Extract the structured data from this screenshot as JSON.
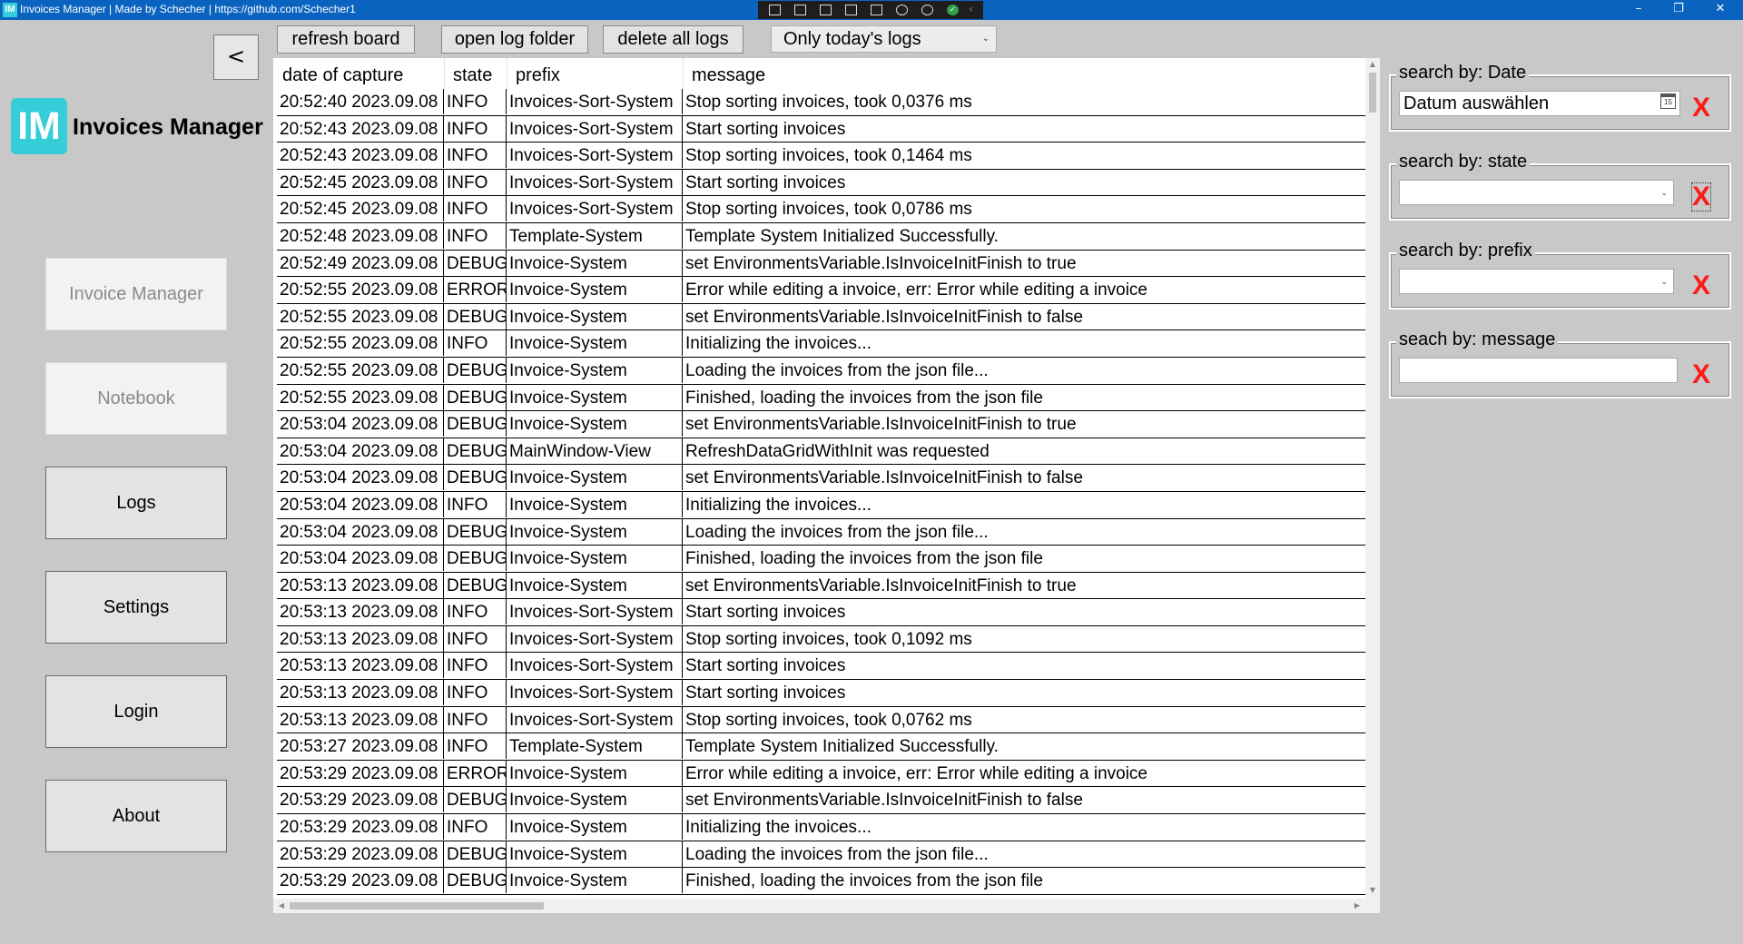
{
  "window": {
    "app_icon_text": "IM",
    "title": "Invoices Manager | Made by Schecher | https://github.com/Schecher1",
    "controls": {
      "minimize": "–",
      "maximize": "❐",
      "close": "✕"
    }
  },
  "sidebar": {
    "back_label": "<",
    "logo_text": "IM",
    "app_name": "Invoices Manager",
    "nav": [
      {
        "label": "Invoice Manager",
        "enabled": false
      },
      {
        "label": "Notebook",
        "enabled": false
      },
      {
        "label": "Logs",
        "enabled": true
      },
      {
        "label": "Settings",
        "enabled": true
      },
      {
        "label": "Login",
        "enabled": true
      },
      {
        "label": "About",
        "enabled": true
      }
    ]
  },
  "toolbar": {
    "refresh_label": "refresh board",
    "open_folder_label": "open log folder",
    "delete_label": "delete all logs",
    "log_filter_value": "Only today's logs"
  },
  "grid": {
    "columns": [
      "date of capture",
      "state",
      "prefix",
      "message"
    ],
    "rows": [
      [
        "20:52:40 2023.09.08",
        "INFO",
        "Invoices-Sort-System",
        "Stop sorting invoices, took 0,0376 ms"
      ],
      [
        "20:52:43 2023.09.08",
        "INFO",
        "Invoices-Sort-System",
        "Start sorting invoices"
      ],
      [
        "20:52:43 2023.09.08",
        "INFO",
        "Invoices-Sort-System",
        "Stop sorting invoices, took 0,1464 ms"
      ],
      [
        "20:52:45 2023.09.08",
        "INFO",
        "Invoices-Sort-System",
        "Start sorting invoices"
      ],
      [
        "20:52:45 2023.09.08",
        "INFO",
        "Invoices-Sort-System",
        "Stop sorting invoices, took 0,0786 ms"
      ],
      [
        "20:52:48 2023.09.08",
        "INFO",
        "Template-System",
        "Template System Initialized Successfully."
      ],
      [
        "20:52:49 2023.09.08",
        "DEBUG",
        "Invoice-System",
        "set EnvironmentsVariable.IsInvoiceInitFinish to true"
      ],
      [
        "20:52:55 2023.09.08",
        "ERROR",
        "Invoice-System",
        "Error while editing a invoice, err: Error while editing a invoice"
      ],
      [
        "20:52:55 2023.09.08",
        "DEBUG",
        "Invoice-System",
        "set EnvironmentsVariable.IsInvoiceInitFinish to false"
      ],
      [
        "20:52:55 2023.09.08",
        "INFO",
        "Invoice-System",
        "Initializing the invoices..."
      ],
      [
        "20:52:55 2023.09.08",
        "DEBUG",
        "Invoice-System",
        "Loading the invoices from the json file..."
      ],
      [
        "20:52:55 2023.09.08",
        "DEBUG",
        "Invoice-System",
        "Finished, loading the invoices from the json file"
      ],
      [
        "20:53:04 2023.09.08",
        "DEBUG",
        "Invoice-System",
        "set EnvironmentsVariable.IsInvoiceInitFinish to true"
      ],
      [
        "20:53:04 2023.09.08",
        "DEBUG",
        "MainWindow-View",
        "RefreshDataGridWithInit was requested"
      ],
      [
        "20:53:04 2023.09.08",
        "DEBUG",
        "Invoice-System",
        "set EnvironmentsVariable.IsInvoiceInitFinish to false"
      ],
      [
        "20:53:04 2023.09.08",
        "INFO",
        "Invoice-System",
        "Initializing the invoices..."
      ],
      [
        "20:53:04 2023.09.08",
        "DEBUG",
        "Invoice-System",
        "Loading the invoices from the json file..."
      ],
      [
        "20:53:04 2023.09.08",
        "DEBUG",
        "Invoice-System",
        "Finished, loading the invoices from the json file"
      ],
      [
        "20:53:13 2023.09.08",
        "DEBUG",
        "Invoice-System",
        "set EnvironmentsVariable.IsInvoiceInitFinish to true"
      ],
      [
        "20:53:13 2023.09.08",
        "INFO",
        "Invoices-Sort-System",
        "Start sorting invoices"
      ],
      [
        "20:53:13 2023.09.08",
        "INFO",
        "Invoices-Sort-System",
        "Stop sorting invoices, took 0,1092 ms"
      ],
      [
        "20:53:13 2023.09.08",
        "INFO",
        "Invoices-Sort-System",
        "Start sorting invoices"
      ],
      [
        "20:53:13 2023.09.08",
        "INFO",
        "Invoices-Sort-System",
        "Start sorting invoices"
      ],
      [
        "20:53:13 2023.09.08",
        "INFO",
        "Invoices-Sort-System",
        "Stop sorting invoices, took 0,0762 ms"
      ],
      [
        "20:53:27 2023.09.08",
        "INFO",
        "Template-System",
        "Template System Initialized Successfully."
      ],
      [
        "20:53:29 2023.09.08",
        "ERROR",
        "Invoice-System",
        "Error while editing a invoice, err: Error while editing a invoice"
      ],
      [
        "20:53:29 2023.09.08",
        "DEBUG",
        "Invoice-System",
        "set EnvironmentsVariable.IsInvoiceInitFinish to false"
      ],
      [
        "20:53:29 2023.09.08",
        "INFO",
        "Invoice-System",
        "Initializing the invoices..."
      ],
      [
        "20:53:29 2023.09.08",
        "DEBUG",
        "Invoice-System",
        "Loading the invoices from the json file..."
      ],
      [
        "20:53:29 2023.09.08",
        "DEBUG",
        "Invoice-System",
        "Finished, loading the invoices from the json file"
      ]
    ]
  },
  "filters": {
    "date": {
      "label": "search by: Date",
      "placeholder": "Datum auswählen",
      "clear": "X",
      "calendar_icon_text": "15"
    },
    "state": {
      "label": "search by: state",
      "value": "",
      "clear": "X"
    },
    "prefix": {
      "label": "search by: prefix",
      "value": "",
      "clear": "X"
    },
    "message": {
      "label": "seach by: message",
      "value": "",
      "clear": "X"
    }
  },
  "colors": {
    "titlebar": "#0a64bf",
    "background": "#c8c8c8",
    "brand": "#35cdd8",
    "clear_x": "#ff1a1a"
  }
}
